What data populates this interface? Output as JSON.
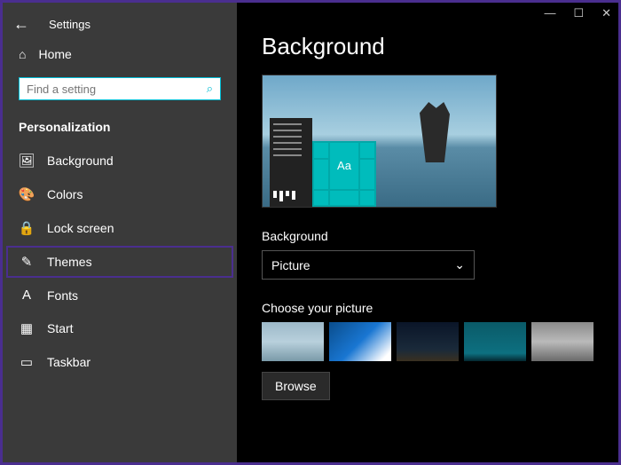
{
  "window": {
    "title": "Settings"
  },
  "sidebar": {
    "home": "Home",
    "search_placeholder": "Find a setting",
    "section": "Personalization",
    "items": [
      {
        "icon": "🖼",
        "label": "Background"
      },
      {
        "icon": "🎨",
        "label": "Colors"
      },
      {
        "icon": "🔒",
        "label": "Lock screen"
      },
      {
        "icon": "✎",
        "label": "Themes"
      },
      {
        "icon": "A",
        "label": "Fonts"
      },
      {
        "icon": "▦",
        "label": "Start"
      },
      {
        "icon": "▭",
        "label": "Taskbar"
      }
    ]
  },
  "content": {
    "heading": "Background",
    "preview_tile_text": "Aa",
    "bg_label": "Background",
    "bg_value": "Picture",
    "choose_label": "Choose your picture",
    "browse": "Browse"
  }
}
